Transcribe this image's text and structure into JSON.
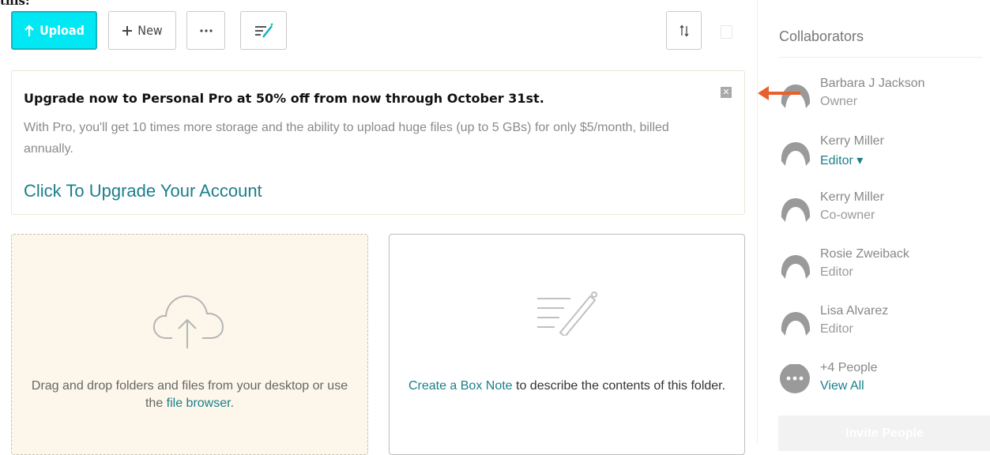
{
  "page_fragment": "this:",
  "toolbar": {
    "upload_label": "Upload",
    "new_label": "New",
    "accent": "#00e8f4"
  },
  "banner": {
    "title": "Upgrade now to Personal Pro at 50% off from now through October 31st.",
    "body": "With Pro, you'll get 10 times more storage and the ability to upload huge files (up to 5 GBs) for only $5/month, billed annually.",
    "cta": "Click To Upgrade Your Account",
    "close_glyph": "✕"
  },
  "dropzone": {
    "text_before": "Drag and drop folders and files from your desktop or use the ",
    "link": "file browser",
    "text_after": "."
  },
  "notecard": {
    "link": "Create a Box Note",
    "text_after": " to describe the contents of this folder."
  },
  "sidebar": {
    "title": "Collaborators",
    "collaborators": [
      {
        "name": "Barbara J Jackson",
        "role": "Owner"
      },
      {
        "name": "Kerry Miller",
        "role": "Editor ▾"
      },
      {
        "name": "Kerry Miller",
        "role": "Co-owner"
      },
      {
        "name": "Rosie Zweiback",
        "role": "Editor"
      },
      {
        "name": "Lisa Alvarez",
        "role": "Editor"
      }
    ],
    "more": {
      "count_label": "+4 People",
      "view_all": "View All"
    },
    "invite_label": "Invite People"
  },
  "colors": {
    "link": "#1a7f8a",
    "arrow": "#e8602c",
    "dropzone_bg": "#fcf7ea"
  }
}
